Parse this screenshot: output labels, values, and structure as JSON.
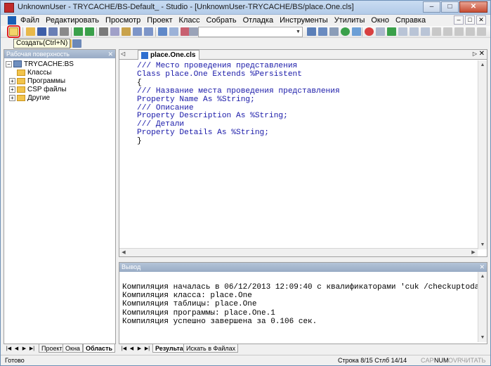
{
  "window": {
    "title": "UnknownUser - TRYCACHE/BS-Default_ - Studio - [UnknownUser-TRYCACHE/BS/place.One.cls]",
    "min_label": "–",
    "max_label": "□",
    "close_label": "✕"
  },
  "menu": {
    "items": [
      "Файл",
      "Редактировать",
      "Просмотр",
      "Проект",
      "Класс",
      "Собрать",
      "Отладка",
      "Инструменты",
      "Утилиты",
      "Окно",
      "Справка"
    ],
    "mdi_controls": [
      "–",
      "□",
      "✕"
    ]
  },
  "toolbar": {
    "combo_value": "",
    "tooltip": "Создать(Ctrl+N)"
  },
  "workspace": {
    "header": "Рабочая поверхность",
    "close": "✕",
    "root": "TRYCACHE:BS",
    "nodes": [
      "Классы",
      "Программы",
      "CSP файлы",
      "Другие"
    ],
    "tabs": [
      "Проект",
      "Окна",
      "Область"
    ],
    "active_tab": "Область"
  },
  "editor": {
    "tab_label": "place.One.cls",
    "tab_arrow": "▷",
    "tab_close": "✕",
    "lines": [
      "/// Место проведения представления",
      "Class place.One Extends %Persistent",
      "{",
      "",
      "/// Название места проведения представления",
      "Property Name As %String;",
      "",
      "/// Описание",
      "Property Description As %String;",
      "",
      "/// Детали",
      "Property Details As %String;",
      "",
      "}"
    ]
  },
  "output": {
    "header": "Вывод",
    "close": "✕",
    "lines": [
      "Компиляция началась в 06/12/2013 12:09:40 с квалификаторами 'cuk /checkuptoda",
      "Компиляция класса: place.One",
      "Компиляция таблицы: place.One",
      "Компиляция программы: place.One.1",
      "Компиляция успешно завершена за 0.106 сек."
    ],
    "tabs": [
      "Результат",
      "Искать в Файлах"
    ],
    "active_tab": "Результат"
  },
  "status": {
    "ready": "Готово",
    "position": "Строка 8/15 Стлб 14/14",
    "indicators": [
      "CAP",
      "NUM",
      "OVR",
      "ЧИТАТЬ"
    ],
    "active_indicators": [
      "NUM"
    ]
  },
  "colors": {
    "comment": "#1818a8",
    "keyword": "#1818a8",
    "panel_header": "#98abc5",
    "highlight_box": "#e02020"
  }
}
